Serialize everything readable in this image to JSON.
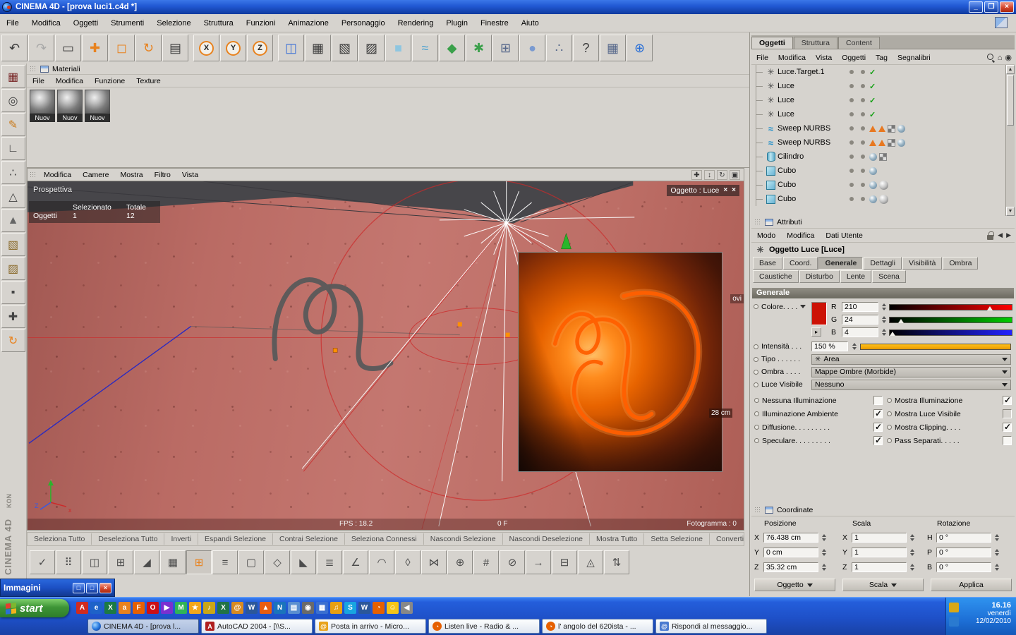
{
  "titlebar": {
    "title": "CINEMA 4D - [prova luci1.c4d *]"
  },
  "menubar": {
    "items": [
      "File",
      "Modifica",
      "Oggetti",
      "Strumenti",
      "Selezione",
      "Struttura",
      "Funzioni",
      "Animazione",
      "Personaggio",
      "Rendering",
      "Plugin",
      "Finestre",
      "Aiuto"
    ]
  },
  "toolbar": {
    "group1": [
      {
        "name": "undo-icon",
        "glyph": "↶",
        "fg": "#3a3a3a"
      },
      {
        "name": "redo-icon",
        "glyph": "↷",
        "fg": "#a8a8a8"
      },
      {
        "name": "live-selection-icon",
        "glyph": "▭",
        "fg": "#3a3a3a"
      },
      {
        "name": "move-icon",
        "glyph": "✚",
        "fg": "#e8821e"
      },
      {
        "name": "scale-icon",
        "glyph": "◻",
        "fg": "#e8821e"
      },
      {
        "name": "rotate-icon",
        "glyph": "↻",
        "fg": "#e8821e"
      },
      {
        "name": "render-film-icon",
        "glyph": "▤",
        "fg": "#3a3a3a"
      }
    ],
    "axis": [
      {
        "name": "lock-x-icon",
        "letter": "X"
      },
      {
        "name": "lock-y-icon",
        "letter": "Y"
      },
      {
        "name": "lock-z-icon",
        "letter": "Z"
      }
    ],
    "group2": [
      {
        "name": "coordinate-system-icon",
        "glyph": "◫",
        "fg": "#3a6fd6"
      },
      {
        "name": "render-view-icon",
        "glyph": "▦",
        "fg": "#3a3a3a"
      },
      {
        "name": "render-active-icon",
        "glyph": "▧",
        "fg": "#3a3a3a"
      },
      {
        "name": "render-settings-icon",
        "glyph": "▨",
        "fg": "#3a3a3a"
      },
      {
        "name": "cube-primitive-icon",
        "glyph": "■",
        "fg": "#8fc6e0"
      },
      {
        "name": "spline-icon",
        "glyph": "≈",
        "fg": "#4aa0d0"
      },
      {
        "name": "nurbs-icon",
        "glyph": "◆",
        "fg": "#3aa04a"
      },
      {
        "name": "modifier-icon",
        "glyph": "✱",
        "fg": "#3aa04a"
      },
      {
        "name": "expand-icon",
        "glyph": "⊞",
        "fg": "#55678a"
      },
      {
        "name": "bone-icon",
        "glyph": "●",
        "fg": "#7a9ad0"
      },
      {
        "name": "particles-icon",
        "glyph": "∴",
        "fg": "#55678a"
      },
      {
        "name": "help-icon",
        "glyph": "?",
        "fg": "#3a3a3a"
      },
      {
        "name": "layout-icon",
        "glyph": "▦",
        "fg": "#55678a"
      },
      {
        "name": "globe-icon",
        "glyph": "⊕",
        "fg": "#2a6fd6"
      }
    ]
  },
  "left_toolbar": {
    "icons": [
      {
        "name": "material-manager-icon",
        "glyph": "▦",
        "fg": "#7a2a2a"
      },
      {
        "name": "layout-browser-icon",
        "glyph": "◎",
        "fg": "#444444"
      },
      {
        "name": "pen-tool-icon",
        "glyph": "✎",
        "fg": "#c97a1a"
      },
      {
        "name": "corner-tool-icon",
        "glyph": "∟",
        "fg": "#444444"
      },
      {
        "name": "points-mode-icon",
        "glyph": "∴",
        "fg": "#444444"
      },
      {
        "name": "edges-mode-icon",
        "glyph": "△",
        "fg": "#444444"
      },
      {
        "name": "polygons-mode-icon",
        "glyph": "▲",
        "fg": "#666666"
      },
      {
        "name": "texture-mode-icon",
        "glyph": "▧",
        "fg": "#8a6a2a"
      },
      {
        "name": "texture-axis-mode-icon",
        "glyph": "▨",
        "fg": "#8a6a2a"
      },
      {
        "name": "points-edit-icon",
        "glyph": "▪",
        "fg": "#444444"
      },
      {
        "name": "object-axis-icon",
        "glyph": "✚",
        "fg": "#444444"
      },
      {
        "name": "rotate-mode-icon",
        "glyph": "↻",
        "fg": "#e8821e"
      }
    ]
  },
  "materials": {
    "title": "Materiali",
    "menus": [
      "File",
      "Modifica",
      "Funzione",
      "Texture"
    ],
    "items": [
      "Nuov",
      "Nuov",
      "Nuov"
    ]
  },
  "viewport": {
    "menus": [
      "Modifica",
      "Camere",
      "Mostra",
      "Filtro",
      "Vista"
    ],
    "icons": [
      {
        "name": "pan-view-icon",
        "glyph": "✚"
      },
      {
        "name": "zoom-view-icon",
        "glyph": "↕"
      },
      {
        "name": "rotate-view-icon",
        "glyph": "↻"
      },
      {
        "name": "maximize-view-icon",
        "glyph": "▣"
      }
    ],
    "view_label": "Prospettiva",
    "hud": {
      "col1": "Selezionato",
      "col2": "Totale",
      "row_label": "Oggetti",
      "val1": "1",
      "val2": "12"
    },
    "badge": "Oggetto : Luce",
    "measure": "28 cm",
    "clipped": "ovi",
    "fps": "FPS : 18.2",
    "frame": "0 F",
    "fotogramma": "Fotogramma : 0"
  },
  "object_manager": {
    "tabs": [
      {
        "label": "Oggetti",
        "active": true
      },
      {
        "label": "Struttura",
        "active": false
      },
      {
        "label": "Content",
        "active": false
      }
    ],
    "menus": [
      "File",
      "Modifica",
      "Vista",
      "Oggetti",
      "Tag",
      "Segnalibri"
    ],
    "tool_icons": [
      {
        "name": "search-icon",
        "glyph": ""
      },
      {
        "name": "home-icon",
        "glyph": "⌂"
      },
      {
        "name": "eye-icon",
        "glyph": "◉"
      }
    ],
    "objects": [
      {
        "name": "Luce.Target.1",
        "type": "light",
        "tags": [
          "check"
        ]
      },
      {
        "name": "Luce",
        "type": "light",
        "tags": [
          "check"
        ]
      },
      {
        "name": "Luce",
        "type": "light",
        "tags": [
          "check"
        ]
      },
      {
        "name": "Luce",
        "type": "light",
        "tags": [
          "check"
        ]
      },
      {
        "name": "Sweep NURBS",
        "type": "nurbs",
        "tags": [
          "triangle",
          "triangle",
          "checker",
          "phong"
        ]
      },
      {
        "name": "Sweep NURBS",
        "type": "nurbs",
        "tags": [
          "triangle",
          "triangle",
          "checker",
          "phong"
        ]
      },
      {
        "name": "Cilindro",
        "type": "cylinder",
        "tags": [
          "phong",
          "checker"
        ]
      },
      {
        "name": "Cubo",
        "type": "cube",
        "tags": [
          "phong"
        ]
      },
      {
        "name": "Cubo",
        "type": "cube",
        "tags": [
          "phong",
          "material"
        ]
      },
      {
        "name": "Cubo",
        "type": "cube",
        "tags": [
          "phong",
          "material"
        ]
      }
    ]
  },
  "attributes": {
    "panel_title": "Attributi",
    "menus": [
      "Modo",
      "Modifica",
      "Dati Utente"
    ],
    "tool_icons": [
      {
        "name": "lock-icon",
        "glyph": ""
      },
      {
        "name": "history-back-icon",
        "glyph": "◀"
      },
      {
        "name": "history-forward-icon",
        "glyph": "▶"
      }
    ],
    "object_title": "Oggetto Luce [Luce]",
    "tabs_row1": [
      {
        "label": "Base"
      },
      {
        "label": "Coord."
      },
      {
        "label": "Generale",
        "active": true
      },
      {
        "label": "Dettagli"
      },
      {
        "label": "Visibilità"
      },
      {
        "label": "Ombra"
      }
    ],
    "tabs_row2": [
      {
        "label": "Caustiche"
      },
      {
        "label": "Disturbo"
      },
      {
        "label": "Lente"
      },
      {
        "label": "Scena"
      }
    ],
    "section_title": "Generale",
    "colore_label": "Colore. . . .",
    "swatch_color": "#cc1205",
    "r_label": "R",
    "r_value": "210",
    "g_label": "G",
    "g_value": "24",
    "b_label": "B",
    "b_value": "4",
    "intensita_label": "Intensità . . .",
    "intensita_value": "150 %",
    "tipo_label": "Tipo . . . . . .",
    "tipo_value": "Area",
    "ombra_label": "Ombra . . . .",
    "ombra_value": "Mappe Ombre (Morbide)",
    "luce_visibile_label": "Luce Visibile",
    "luce_visibile_value": "Nessuno",
    "checks_left": [
      {
        "label": "Nessuna Illuminazione",
        "checked": false
      },
      {
        "label": "Illuminazione Ambiente",
        "checked": true
      },
      {
        "label": "Diffusione. . . . . . . . .",
        "checked": true
      },
      {
        "label": "Speculare. . . . . . . . .",
        "checked": true
      }
    ],
    "checks_right": [
      {
        "label": "Mostra Illuminazione",
        "checked": true
      },
      {
        "label": "Mostra Luce Visibile",
        "checked": false,
        "disabled": true
      },
      {
        "label": "Mostra Clipping. . . .",
        "checked": true
      },
      {
        "label": "Pass Separati. . . . .",
        "checked": false
      }
    ]
  },
  "coordinates": {
    "panel_title": "Coordinate",
    "headers": [
      "Posizione",
      "Scala",
      "Rotazione"
    ],
    "posizione": [
      {
        "axis": "X",
        "value": "76.438 cm"
      },
      {
        "axis": "Y",
        "value": "0 cm"
      },
      {
        "axis": "Z",
        "value": "35.32 cm"
      }
    ],
    "scala": [
      {
        "axis": "X",
        "value": "1"
      },
      {
        "axis": "Y",
        "value": "1"
      },
      {
        "axis": "Z",
        "value": "1"
      }
    ],
    "rotazione": [
      {
        "axis": "H",
        "value": "0 °"
      },
      {
        "axis": "P",
        "value": "0 °"
      },
      {
        "axis": "B",
        "value": "0 °"
      }
    ],
    "btn_oggetto": "Oggetto",
    "btn_scala": "Scala",
    "btn_applica": "Applica"
  },
  "selection_bar": {
    "items": [
      "Seleziona Tutto",
      "Deseleziona Tutto",
      "Inverti",
      "Espandi Selezione",
      "Contrai Selezione",
      "Seleziona Connessi",
      "Nascondi Selezione",
      "Nascondi Deselezione",
      "Mostra Tutto",
      "Setta Selezione",
      "Converti Selez"
    ]
  },
  "modeling_bar": {
    "icons": [
      {
        "name": "checkmark-tool-icon",
        "glyph": "✓"
      },
      {
        "name": "magnet-tool-icon",
        "glyph": "⠿"
      },
      {
        "name": "mirror-tool-icon",
        "glyph": "◫"
      },
      {
        "name": "extrude-tool-icon",
        "glyph": "⊞"
      },
      {
        "name": "bevel-tool-icon",
        "glyph": "◢"
      },
      {
        "name": "matrix-tool-icon",
        "glyph": "▦"
      },
      {
        "name": "add-cube-tool-icon",
        "glyph": "⊞",
        "active": true
      },
      {
        "name": "array-tool-icon",
        "glyph": "≡"
      },
      {
        "name": "plane-tool-icon",
        "glyph": "▢"
      },
      {
        "name": "knife-tool-icon",
        "glyph": "◇"
      },
      {
        "name": "slope-tool-icon",
        "glyph": "◣"
      },
      {
        "name": "layers-tool-icon",
        "glyph": "≣"
      },
      {
        "name": "angle-tool-icon",
        "glyph": "∠"
      },
      {
        "name": "arc-tool-icon",
        "glyph": "◠"
      },
      {
        "name": "diamond-tool-icon",
        "glyph": "◊"
      },
      {
        "name": "bowtie-tool-icon",
        "glyph": "⋈"
      },
      {
        "name": "weld-tool-icon",
        "glyph": "⊕"
      },
      {
        "name": "grid-tool-icon",
        "glyph": "#"
      },
      {
        "name": "disconnect-tool-icon",
        "glyph": "⊘"
      },
      {
        "name": "arrow-tool-icon",
        "glyph": "→"
      },
      {
        "name": "close-hole-tool-icon",
        "glyph": "⊟"
      },
      {
        "name": "edge-tool-icon",
        "glyph": "◬"
      },
      {
        "name": "swap-tool-icon",
        "glyph": "⇅"
      }
    ]
  },
  "side_brand": {
    "small": "KON",
    "large": "CINEMA 4D"
  },
  "immagini": {
    "title": "Immagini",
    "buttons": [
      {
        "name": "popout-icon",
        "glyph": "□"
      },
      {
        "name": "minimize-icon",
        "glyph": "□"
      },
      {
        "name": "close-icon",
        "glyph": "×",
        "type": "close"
      }
    ]
  },
  "taskbar": {
    "start_label": "start",
    "quick_launch": [
      {
        "name": "acrobat-icon",
        "glyph": "A",
        "bg": "#d02b20"
      },
      {
        "name": "ie-icon",
        "glyph": "e",
        "bg": "#1e62c8"
      },
      {
        "name": "excel-icon",
        "glyph": "X",
        "bg": "#1c7a43"
      },
      {
        "name": "app-a-icon",
        "glyph": "a",
        "bg": "#e8821e"
      },
      {
        "name": "firefox-icon",
        "glyph": "F",
        "bg": "#e66000"
      },
      {
        "name": "opera-icon",
        "glyph": "O",
        "bg": "#cc0f16"
      },
      {
        "name": "media-player-icon",
        "glyph": "▶",
        "bg": "#7a2fd0"
      },
      {
        "name": "messenger-icon",
        "glyph": "M",
        "bg": "#2fb457"
      },
      {
        "name": "star-icon",
        "glyph": "★",
        "bg": "#f2a71b"
      },
      {
        "name": "audio-icon",
        "glyph": "♪",
        "bg": "#caa616"
      },
      {
        "name": "excel2-icon",
        "glyph": "X",
        "bg": "#217346"
      },
      {
        "name": "outlook-icon",
        "glyph": "@",
        "bg": "#d98b21"
      },
      {
        "name": "word-icon",
        "glyph": "W",
        "bg": "#2b579a"
      },
      {
        "name": "vlc-icon",
        "glyph": "▲",
        "bg": "#e85d10"
      },
      {
        "name": "writer-icon",
        "glyph": "N",
        "bg": "#1a74bc"
      },
      {
        "name": "notepad-icon",
        "glyph": "▤",
        "bg": "#5a8fd0"
      },
      {
        "name": "gimp-icon",
        "glyph": "◉",
        "bg": "#6a6a6a"
      },
      {
        "name": "calc-icon",
        "glyph": "▦",
        "bg": "#3a6fd0"
      },
      {
        "name": "winamp-icon",
        "glyph": "♫",
        "bg": "#e8a012"
      },
      {
        "name": "skype-icon",
        "glyph": "S",
        "bg": "#18a5e0"
      },
      {
        "name": "word2-icon",
        "glyph": "W",
        "bg": "#2b579a"
      },
      {
        "name": "firefox2-icon",
        "glyph": "◔",
        "bg": "#e66000"
      },
      {
        "name": "smiley-icon",
        "glyph": "☺",
        "bg": "#f5c518"
      },
      {
        "name": "volume-icon",
        "glyph": "◀",
        "bg": "#888888"
      }
    ],
    "tasks": [
      {
        "label": "CINEMA 4D - [prova l...",
        "type": "c4d",
        "active": true
      },
      {
        "label": "AutoCAD 2004 - [\\\\S...",
        "type": "autocad"
      },
      {
        "label": "Posta in arrivo - Micro...",
        "type": "outlook"
      },
      {
        "label": "Listen live - Radio & ...",
        "type": "firefox"
      },
      {
        "label": "l' angolo del 620ista - ...",
        "type": "firefox"
      },
      {
        "label": "Rispondi al messaggio...",
        "type": "mail"
      }
    ],
    "tray_icons": [
      {
        "name": "tray-app-icon-1",
        "bg": "#d8a818"
      },
      {
        "name": "tray-app-icon-2",
        "bg": "#2a7ad0"
      }
    ],
    "tray": {
      "time": "16.16",
      "day": "venerdì",
      "date": "12/02/2010"
    }
  }
}
